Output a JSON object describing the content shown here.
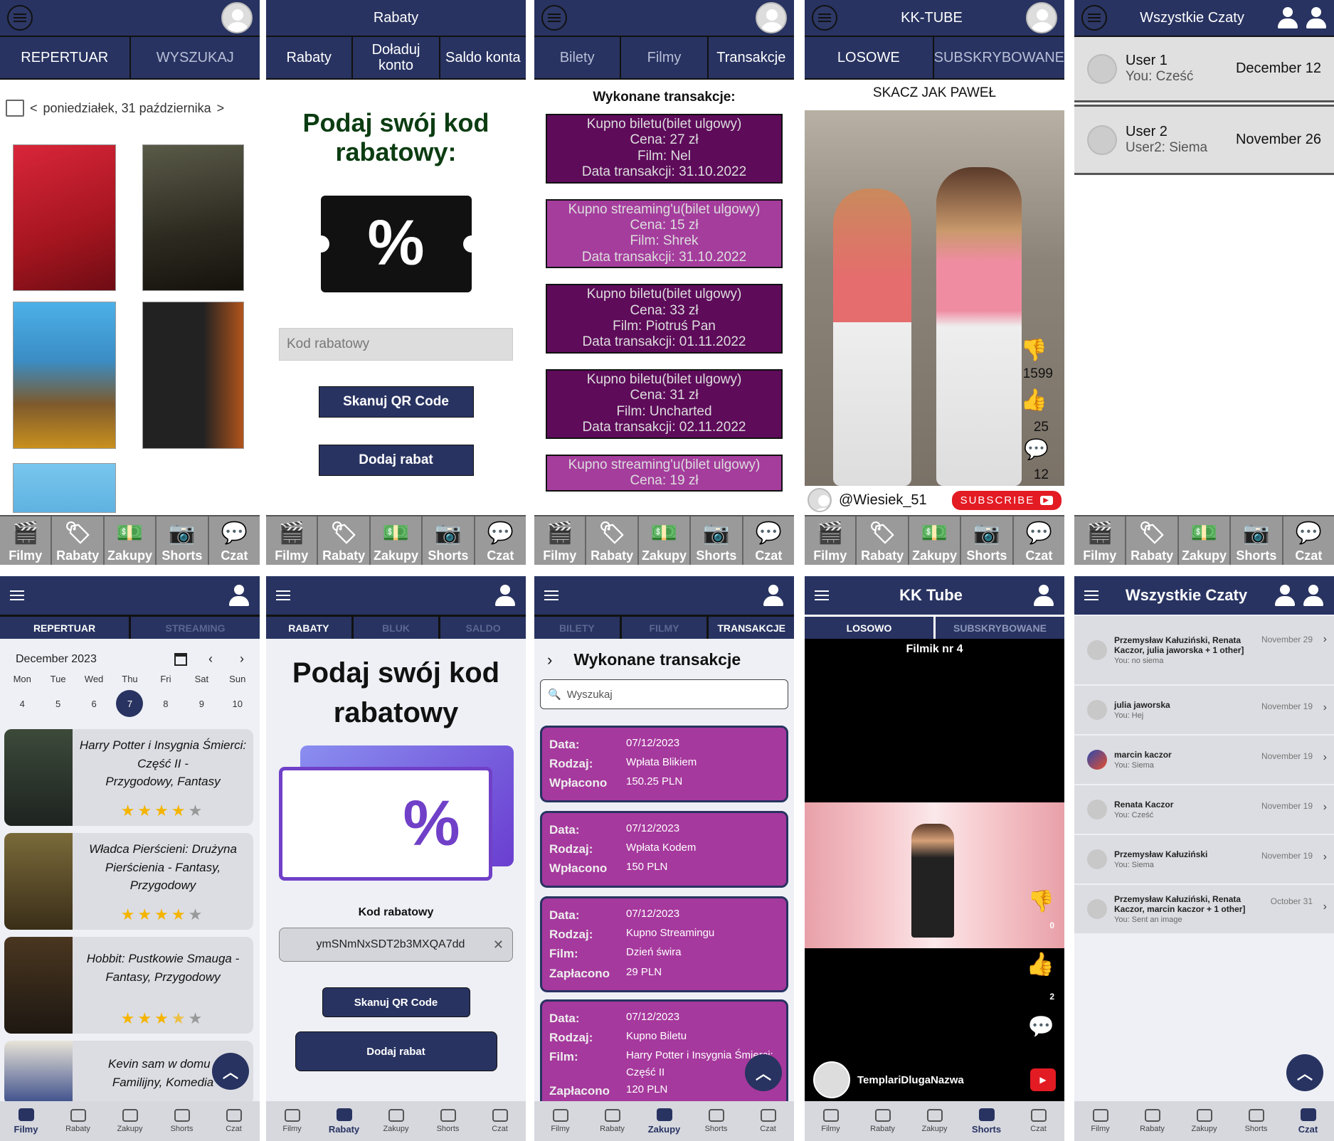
{
  "nav": {
    "filmy": "Filmy",
    "rabaty": "Rabaty",
    "zakupy": "Zakupy",
    "shorts": "Shorts",
    "czat": "Czat"
  },
  "old_repertoire": {
    "tab_repertuar": "REPERTUAR",
    "tab_wyszukaj": "WYSZUKAJ",
    "date_prev": "<",
    "date": "poniedziałek, 31 października",
    "date_next": ">"
  },
  "old_rabaty": {
    "title": "Rabaty",
    "tab_rabaty": "Rabaty",
    "tab_doladuj": "Doładuj konto",
    "tab_saldo": "Saldo konta",
    "heading": "Podaj swój kod rabatowy:",
    "input_placeholder": "Kod rabatowy",
    "scan_button": "Skanuj QR Code",
    "add_button": "Dodaj rabat"
  },
  "old_transactions": {
    "tab_bilety": "Bilety",
    "tab_filmy": "Filmy",
    "tab_transakcje": "Transakcje",
    "heading": "Wykonane transakcje:",
    "items": [
      {
        "l1": "Kupno biletu(bilet ulgowy)",
        "l2": "Cena: 27 zł",
        "l3": "Film: Nel",
        "l4": "Data transakcji: 31.10.2022"
      },
      {
        "l1": "Kupno streaming'u(bilet ulgowy)",
        "l2": "Cena: 15 zł",
        "l3": "Film: Shrek",
        "l4": "Data transakcji: 31.10.2022"
      },
      {
        "l1": "Kupno biletu(bilet ulgowy)",
        "l2": "Cena: 33 zł",
        "l3": "Film: Piotruś Pan",
        "l4": "Data transakcji: 01.11.2022"
      },
      {
        "l1": "Kupno biletu(bilet ulgowy)",
        "l2": "Cena: 31 zł",
        "l3": "Film: Uncharted",
        "l4": "Data transakcji: 02.11.2022"
      },
      {
        "l1": "Kupno streaming'u(bilet ulgowy)",
        "l2": "Cena: 19 zł"
      }
    ]
  },
  "old_tube": {
    "title": "KK-TUBE",
    "tab_losowe": "LOSOWE",
    "tab_sub": "SUBSKRYBOWANE",
    "video_title": "SKACZ JAK PAWEŁ",
    "dislikes": "1599",
    "likes": "25",
    "comments": "12",
    "channel": "@Wiesiek_51",
    "subscribe": "SUBSCRIBE"
  },
  "old_chats": {
    "title": "Wszystkie Czaty",
    "items": [
      {
        "name": "User 1",
        "last": "You: Cześć",
        "date": "December 12"
      },
      {
        "name": "User 2",
        "last": "User2: Siema",
        "date": "November 26"
      }
    ]
  },
  "new_repertoire": {
    "tab_repertuar": "REPERTUAR",
    "tab_streaming": "STREAMING",
    "month": "December 2023",
    "days": [
      "Mon",
      "Tue",
      "Wed",
      "Thu",
      "Fri",
      "Sat",
      "Sun"
    ],
    "dates": [
      "4",
      "5",
      "6",
      "7",
      "8",
      "9",
      "10"
    ],
    "films": [
      {
        "title": "Harry Potter i Insygnia Śmierci: Część II -",
        "genre": "Przygodowy, Fantasy",
        "rating": 4
      },
      {
        "title": "Władca Pierścieni: Drużyna Pierścienia - Fantasy,",
        "genre": "Przygodowy",
        "rating": 4
      },
      {
        "title": "Hobbit: Pustkowie Smauga -",
        "genre": "Fantasy, Przygodowy",
        "rating": 3.5
      },
      {
        "title": "Kevin sam w domu -",
        "genre": "Familijny, Komedia"
      }
    ]
  },
  "new_rabaty": {
    "tab_rabaty": "RABATY",
    "tab_bluk": "BLUK",
    "tab_saldo": "SALDO",
    "heading": "Podaj swój kod rabatowy",
    "label": "Kod rabatowy",
    "input_value": "ymSNmNxSDT2b3MXQA7dd",
    "scan_button": "Skanuj QR Code",
    "add_button": "Dodaj rabat"
  },
  "new_transactions": {
    "tab_bilety": "BILETY",
    "tab_filmy": "FILMY",
    "tab_transakcje": "TRANSAKCJE",
    "heading": "Wykonane transakcje",
    "search_placeholder": "Wyszukaj",
    "items": [
      {
        "data_k": "Data:",
        "data_v": "07/12/2023",
        "rodzaj_k": "Rodzaj:",
        "rodzaj_v": "Wpłata Blikiem",
        "kwota_k": "Wpłacono",
        "kwota_v": "150.25 PLN"
      },
      {
        "data_k": "Data:",
        "data_v": "07/12/2023",
        "rodzaj_k": "Rodzaj:",
        "rodzaj_v": "Wpłata Kodem",
        "kwota_k": "Wpłacono",
        "kwota_v": "150 PLN"
      },
      {
        "data_k": "Data:",
        "data_v": "07/12/2023",
        "rodzaj_k": "Rodzaj:",
        "rodzaj_v": "Kupno Streamingu",
        "film_k": "Film:",
        "film_v": "Dzień świra",
        "kwota_k": "Zapłacono",
        "kwota_v": "29 PLN"
      },
      {
        "data_k": "Data:",
        "data_v": "07/12/2023",
        "rodzaj_k": "Rodzaj:",
        "rodzaj_v": "Kupno Biletu",
        "film_k": "Film:",
        "film_v": "Harry Potter i Insygnia Śmierci: Część II",
        "kwota_k": "Zapłacono",
        "kwota_v": "120 PLN"
      }
    ]
  },
  "new_tube": {
    "title": "KK Tube",
    "tab_losowo": "LOSOWO",
    "tab_sub": "SUBSKRYBOWANE",
    "video_title": "Filmik nr 4",
    "dislikes": "0",
    "likes": "2",
    "channel": "TemplariDlugaNazwa"
  },
  "new_chats": {
    "title": "Wszystkie Czaty",
    "items": [
      {
        "name": "Przemysław Kałuziński, Renata Kaczor, julia jaworska + 1 other]",
        "last": "You: no siema",
        "date": "November 29"
      },
      {
        "name": "julia jaworska",
        "last": "You: Hej",
        "date": "November 19"
      },
      {
        "name": "marcin kaczor",
        "last": "You: Siema",
        "date": "November 19"
      },
      {
        "name": "Renata Kaczor",
        "last": "You: Cześć",
        "date": "November 19"
      },
      {
        "name": "Przemysław Kałuziński",
        "last": "You: Siema",
        "date": "November 19"
      },
      {
        "name": "Przemysław Kałuziński, Renata Kaczor, marcin kaczor + 1 other]",
        "last": "You: Sent an image",
        "date": "October 31"
      }
    ]
  },
  "colors": {
    "navy": "#283361",
    "purple_dark": "#5e0b5a",
    "purple_light": "#a53d9d",
    "green_heading": "#0c3d12",
    "star": "#f4b400",
    "subscribe_red": "#e31b23"
  }
}
